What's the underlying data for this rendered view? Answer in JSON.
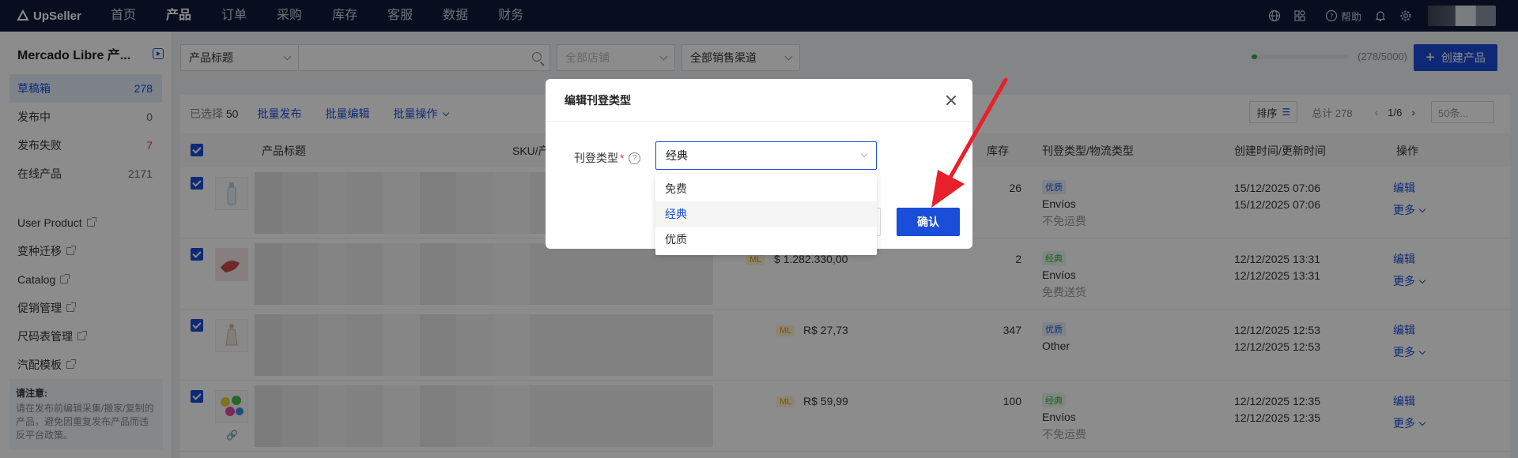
{
  "app": {
    "logo_text": "UpSeller"
  },
  "topnav": {
    "items": [
      "首页",
      "产品",
      "订单",
      "采购",
      "库存",
      "客服",
      "数据",
      "财务"
    ],
    "active_index": 1,
    "help_label": "帮助"
  },
  "sidebar": {
    "title": "Mercado Libre 产...",
    "items": [
      {
        "label": "草稿箱",
        "count": "278"
      },
      {
        "label": "发布中",
        "count": "0"
      },
      {
        "label": "发布失败",
        "count": "7"
      },
      {
        "label": "在线产品",
        "count": "2171"
      }
    ],
    "links": [
      "User Product",
      "变种迁移",
      "Catalog",
      "促销管理",
      "尺码表管理",
      "汽配模板"
    ],
    "notice_title": "请注意:",
    "notice_text": "请在发布前编辑采集/搬家/复制的产品，避免因重复发布产品而违反平台政策。"
  },
  "filters": {
    "field_select": "产品标题",
    "search_placeholder": "",
    "store_select": "全部店铺",
    "channel_select": "全部销售渠道",
    "quota_text": "(278/5000)",
    "quota_fraction": 0.0556,
    "create_label": "创建产品"
  },
  "toolbar": {
    "selected_prefix": "已选择",
    "selected_count": "50",
    "batch_publish": "批量发布",
    "batch_edit": "批量编辑",
    "batch_ops": "批量操作",
    "sort_label": "排序",
    "total_text": "总计 278",
    "page_text": "1/6",
    "page_size": "50条..."
  },
  "table": {
    "headers": [
      "产品标题",
      "SKU/产",
      "库存",
      "刊登类型/物流类型",
      "创建时间/更新时间",
      "操作"
    ],
    "rows": [
      {
        "price": "",
        "stock": "26",
        "listing_type": "优质",
        "logistics": "Envíos",
        "shipping_note": "不免运费",
        "created": "15/12/2025 07:06",
        "updated": "15/12/2025 07:06"
      },
      {
        "price": "$ 1.282.330,00",
        "stock": "2",
        "listing_type": "经典",
        "logistics": "Envíos",
        "shipping_note": "免费送货",
        "created": "12/12/2025 13:31",
        "updated": "12/12/2025 13:31"
      },
      {
        "price": "R$ 27,73",
        "stock": "347",
        "listing_type": "优质",
        "logistics": "Other",
        "shipping_note": "",
        "created": "12/12/2025 12:53",
        "updated": "12/12/2025 12:53"
      },
      {
        "price": "R$ 59,99",
        "stock": "100",
        "listing_type": "经典",
        "logistics": "Envíos",
        "shipping_note": "不免运费",
        "created": "12/12/2025 12:35",
        "updated": "12/12/2025 12:35"
      }
    ],
    "ml_badge": "ML",
    "edit_label": "编辑",
    "more_label": "更多"
  },
  "modal": {
    "title": "编辑刊登类型",
    "field_label": "刊登类型",
    "required_mark": "*",
    "help_glyph": "?",
    "selected_value": "经典",
    "options": [
      "免费",
      "经典",
      "优质"
    ],
    "selected_index": 1,
    "confirm_label": "确认"
  },
  "colors": {
    "nav_bg": "#0f1a3a",
    "primary": "#1a4ed8",
    "annotation_arrow": "#e8202a"
  }
}
